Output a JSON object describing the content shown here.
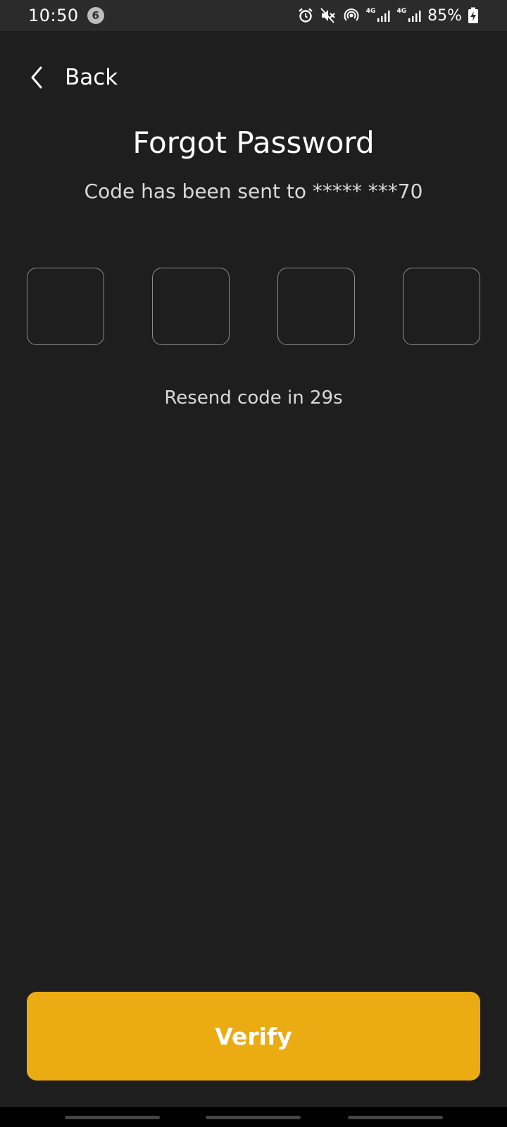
{
  "status_bar": {
    "time": "10:50",
    "notification_count": "6",
    "network_1": "4G",
    "network_2": "4G",
    "battery": "85%"
  },
  "header": {
    "back_label": "Back"
  },
  "main": {
    "title": "Forgot Password",
    "subtitle": "Code has been sent to ***** ***70",
    "code_digits": [
      "",
      "",
      "",
      ""
    ],
    "resend_text": "Resend code in 29s"
  },
  "footer": {
    "verify_label": "Verify"
  },
  "colors": {
    "background": "#1e1e1e",
    "accent": "#ebab12",
    "status_bar": "#2b2b2b",
    "box_border": "#8c8c8c"
  },
  "icons": {
    "back": "chevron-left-icon",
    "alarm": "alarm-icon",
    "mute": "mute-icon",
    "hotspot": "hotspot-icon",
    "signal": "signal-icon",
    "battery": "battery-charging-icon"
  }
}
